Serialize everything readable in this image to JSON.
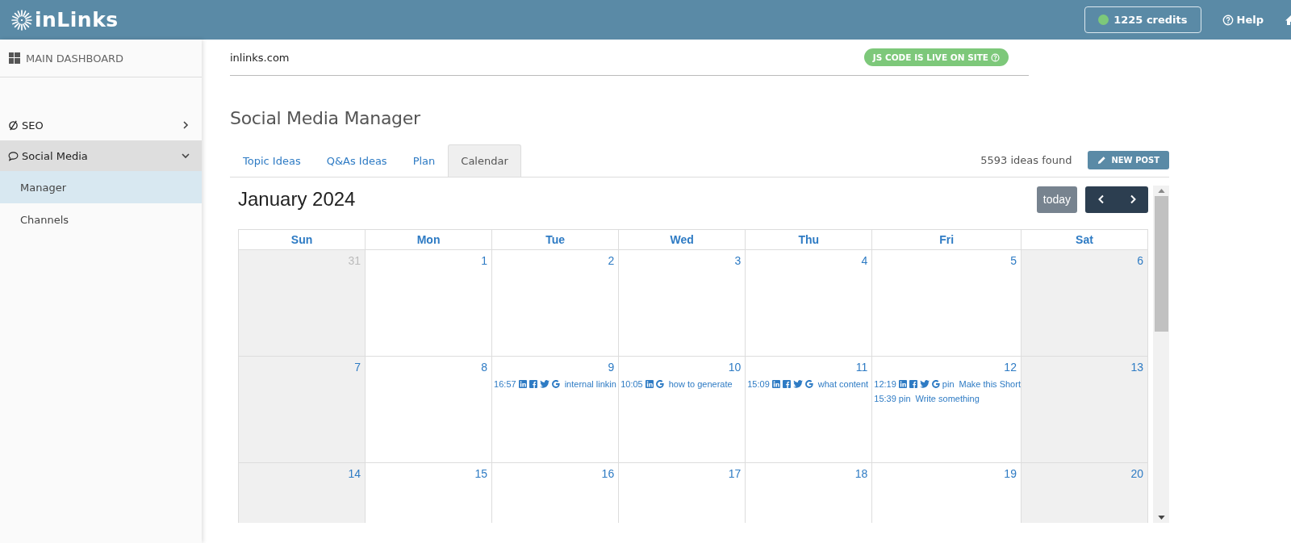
{
  "header": {
    "logo": "inLinks",
    "credits": {
      "label": "1225 credits",
      "color": "#7dc87a"
    },
    "help": "Help"
  },
  "sidebar": {
    "dashboard": "MAIN DASHBOARD",
    "items": [
      {
        "label": "SEO",
        "kind": "seo",
        "expanded": false
      },
      {
        "label": "Social Media",
        "kind": "social",
        "expanded": true,
        "children": [
          {
            "label": "Manager",
            "selected": true
          },
          {
            "label": "Channels",
            "selected": false
          }
        ]
      }
    ]
  },
  "site": {
    "domain": "inlinks.com",
    "status": "JS CODE IS LIVE ON SITE"
  },
  "page_title": "Social Media Manager",
  "tabs": [
    {
      "label": "Topic Ideas",
      "selected": false
    },
    {
      "label": "Q&As Ideas",
      "selected": false
    },
    {
      "label": "Plan",
      "selected": false
    },
    {
      "label": "Calendar",
      "selected": true
    }
  ],
  "ideas_count": "5593 ideas found",
  "new_post": "NEW POST",
  "calendar": {
    "title": "January 2024",
    "today": "today",
    "weekdays": [
      "Sun",
      "Mon",
      "Tue",
      "Wed",
      "Thu",
      "Fri",
      "Sat"
    ],
    "weeks": [
      [
        {
          "num": "31",
          "other_month": true
        },
        {
          "num": "1",
          "other_month": false
        },
        {
          "num": "2",
          "other_month": false
        },
        {
          "num": "3",
          "other_month": false
        },
        {
          "num": "4",
          "other_month": false
        },
        {
          "num": "5",
          "other_month": false
        },
        {
          "num": "6",
          "other_month": false
        }
      ],
      [
        {
          "num": "7",
          "other_month": false
        },
        {
          "num": "8",
          "other_month": false
        },
        {
          "num": "9",
          "other_month": false,
          "events": [
            {
              "time": "16:57",
              "channels": [
                {
                  "kind": "linkedin"
                },
                {
                  "kind": "facebook"
                },
                {
                  "kind": "twitter"
                },
                {
                  "kind": "google"
                }
              ],
              "title": "internal linkin"
            }
          ]
        },
        {
          "num": "10",
          "other_month": false,
          "events": [
            {
              "time": "10:05",
              "channels": [
                {
                  "kind": "linkedin"
                },
                {
                  "kind": "google"
                }
              ],
              "title": "how to generate"
            }
          ]
        },
        {
          "num": "11",
          "other_month": false,
          "events": [
            {
              "time": "15:09",
              "channels": [
                {
                  "kind": "linkedin"
                },
                {
                  "kind": "facebook"
                },
                {
                  "kind": "twitter"
                },
                {
                  "kind": "google"
                }
              ],
              "title": "what content"
            }
          ]
        },
        {
          "num": "12",
          "other_month": false,
          "events": [
            {
              "time": "12:19",
              "channels": [
                {
                  "kind": "linkedin"
                },
                {
                  "kind": "facebook"
                },
                {
                  "kind": "twitter"
                },
                {
                  "kind": "google"
                },
                {
                  "kind": "label",
                  "text": "pin"
                }
              ],
              "title": "Make this Short"
            },
            {
              "time": "15:39",
              "channels": [
                {
                  "kind": "label",
                  "text": "pin"
                }
              ],
              "title": "Write something"
            }
          ]
        },
        {
          "num": "13",
          "other_month": false
        }
      ],
      [
        {
          "num": "14",
          "other_month": false
        },
        {
          "num": "15",
          "other_month": false
        },
        {
          "num": "16",
          "other_month": false
        },
        {
          "num": "17",
          "other_month": false
        },
        {
          "num": "18",
          "other_month": false
        },
        {
          "num": "19",
          "other_month": false
        },
        {
          "num": "20",
          "other_month": false
        }
      ]
    ]
  }
}
